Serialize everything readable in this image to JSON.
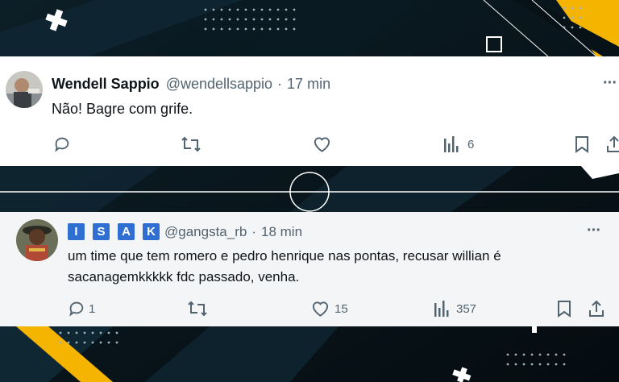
{
  "tweets": [
    {
      "display_name": "Wendell Sappio",
      "handle": "@wendellsappio",
      "separator": "·",
      "time": "17 min",
      "text": "Não! Bagre com grife.",
      "more": "···",
      "actions": {
        "reply": "",
        "retweet": "",
        "like": "",
        "views": "6"
      }
    },
    {
      "display_name_letters": [
        "I",
        "S",
        "A",
        "K"
      ],
      "handle": "@gangsta_rb",
      "separator": "·",
      "time": "18 min",
      "text_line1": "um time que tem romero e pedro henrique nas pontas, recusar willian é",
      "text_line2": "sacanagemkkkkk fdc passado, venha.",
      "more": "···",
      "actions": {
        "reply": "1",
        "retweet": "",
        "like": "15",
        "views": "357"
      }
    }
  ],
  "colors": {
    "accent_yellow": "#f5b400",
    "background": "#071218",
    "isak_box": "#2f6fd1"
  }
}
